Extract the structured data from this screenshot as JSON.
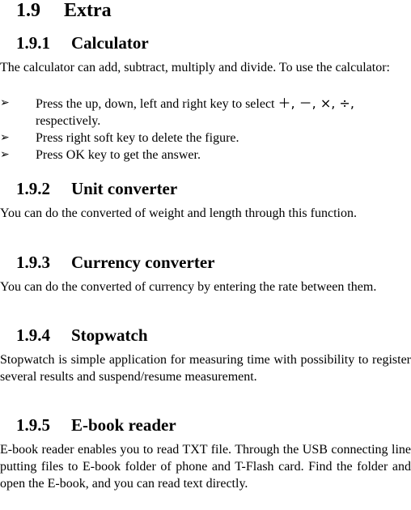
{
  "section": {
    "number": "1.9",
    "title": "Extra"
  },
  "subsections": [
    {
      "number": "1.9.1",
      "title": "Calculator",
      "body": "The calculator can add, subtract, multiply and divide. To use the calculator:",
      "bullet_icon": "arrowhead-bullet-icon",
      "bullets": [
        {
          "text_before": "Press the up, down, left and right key to select ",
          "symbols": "＋, －, ×, ÷,",
          "text_after": " respectively."
        },
        {
          "text": "Press right soft key to delete the figure."
        },
        {
          "text": "Press OK key to get the answer."
        }
      ]
    },
    {
      "number": "1.9.2",
      "title": "Unit converter",
      "body": "You can do the converted of weight and length through this function."
    },
    {
      "number": "1.9.3",
      "title": "Currency converter",
      "body": "You can do the converted of currency by entering the rate between them."
    },
    {
      "number": "1.9.4",
      "title": "Stopwatch",
      "body": "Stopwatch is simple application for measuring time with possibility to register several results and suspend/resume measurement."
    },
    {
      "number": "1.9.5",
      "title": "E-book reader",
      "body": "E-book reader enables you to read TXT file. Through the USB connecting line putting files to E-book folder of phone and T-Flash card. Find the folder and open the E-book, and you can read text directly."
    }
  ],
  "bullet_glyph": "➢"
}
